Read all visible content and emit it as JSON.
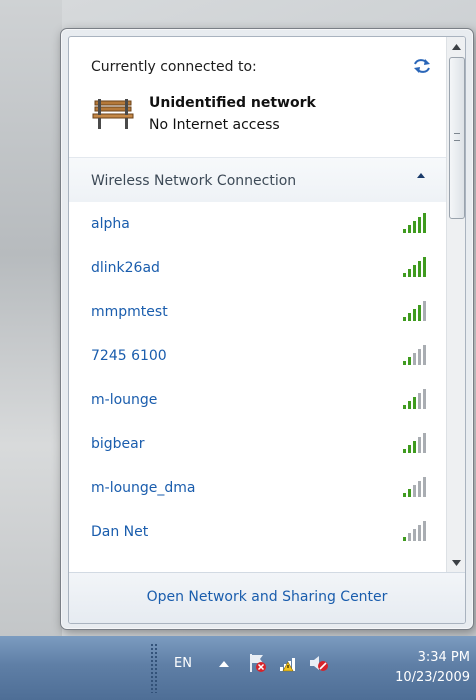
{
  "flyout": {
    "connected_label": "Currently connected to:",
    "current_network": {
      "name": "Unidentified network",
      "status": "No Internet access",
      "icon": "park-bench-icon"
    },
    "section_title": "Wireless Network Connection",
    "networks": [
      {
        "ssid": "alpha",
        "signal_bars": 5
      },
      {
        "ssid": "dlink26ad",
        "signal_bars": 5
      },
      {
        "ssid": "mmpmtest",
        "signal_bars": 4
      },
      {
        "ssid": "7245 6100",
        "signal_bars": 2
      },
      {
        "ssid": "m-lounge",
        "signal_bars": 3
      },
      {
        "ssid": "bigbear",
        "signal_bars": 3
      },
      {
        "ssid": "m-lounge_dma",
        "signal_bars": 2
      },
      {
        "ssid": "Dan Net",
        "signal_bars": 1
      }
    ],
    "footer_link": "Open Network and Sharing Center"
  },
  "taskbar": {
    "language": "EN",
    "time": "3:34 PM",
    "date": "10/23/2009"
  },
  "colors": {
    "link": "#1a5dad",
    "signal_on": "#3f9b1f",
    "signal_off": "#a9adb2",
    "taskbar": "#5f7fa6"
  }
}
